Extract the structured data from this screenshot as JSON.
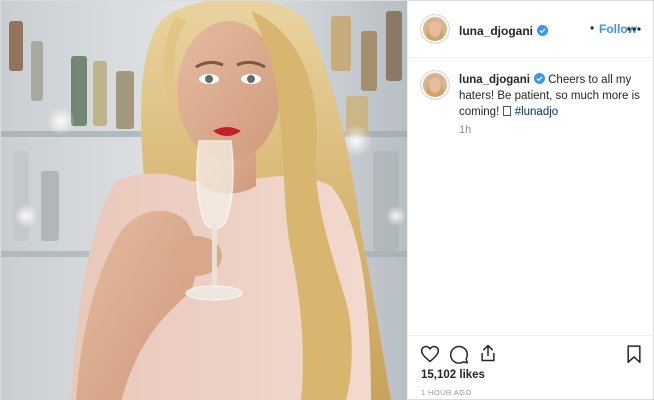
{
  "post": {
    "username": "luna_djogani",
    "follow_label": "Follow",
    "dot_separator": "•",
    "caption_text": "Cheers to all my haters! Be patient, so much more is coming!",
    "caption_hashtag": "#lunadjo",
    "caption_time": "1h",
    "likes": "15,102 likes",
    "timestamp": "1 HOUR AGO",
    "verified": true
  },
  "icons": {
    "like": "heart-icon",
    "comment": "comment-icon",
    "share": "share-icon",
    "save": "bookmark-icon",
    "more": "more-options-icon",
    "verified": "verified-badge-icon"
  },
  "colors": {
    "accent": "#3897f0",
    "hashtag": "#003569",
    "muted": "#8e8e8e",
    "text": "#262626",
    "divider": "#efefef"
  }
}
